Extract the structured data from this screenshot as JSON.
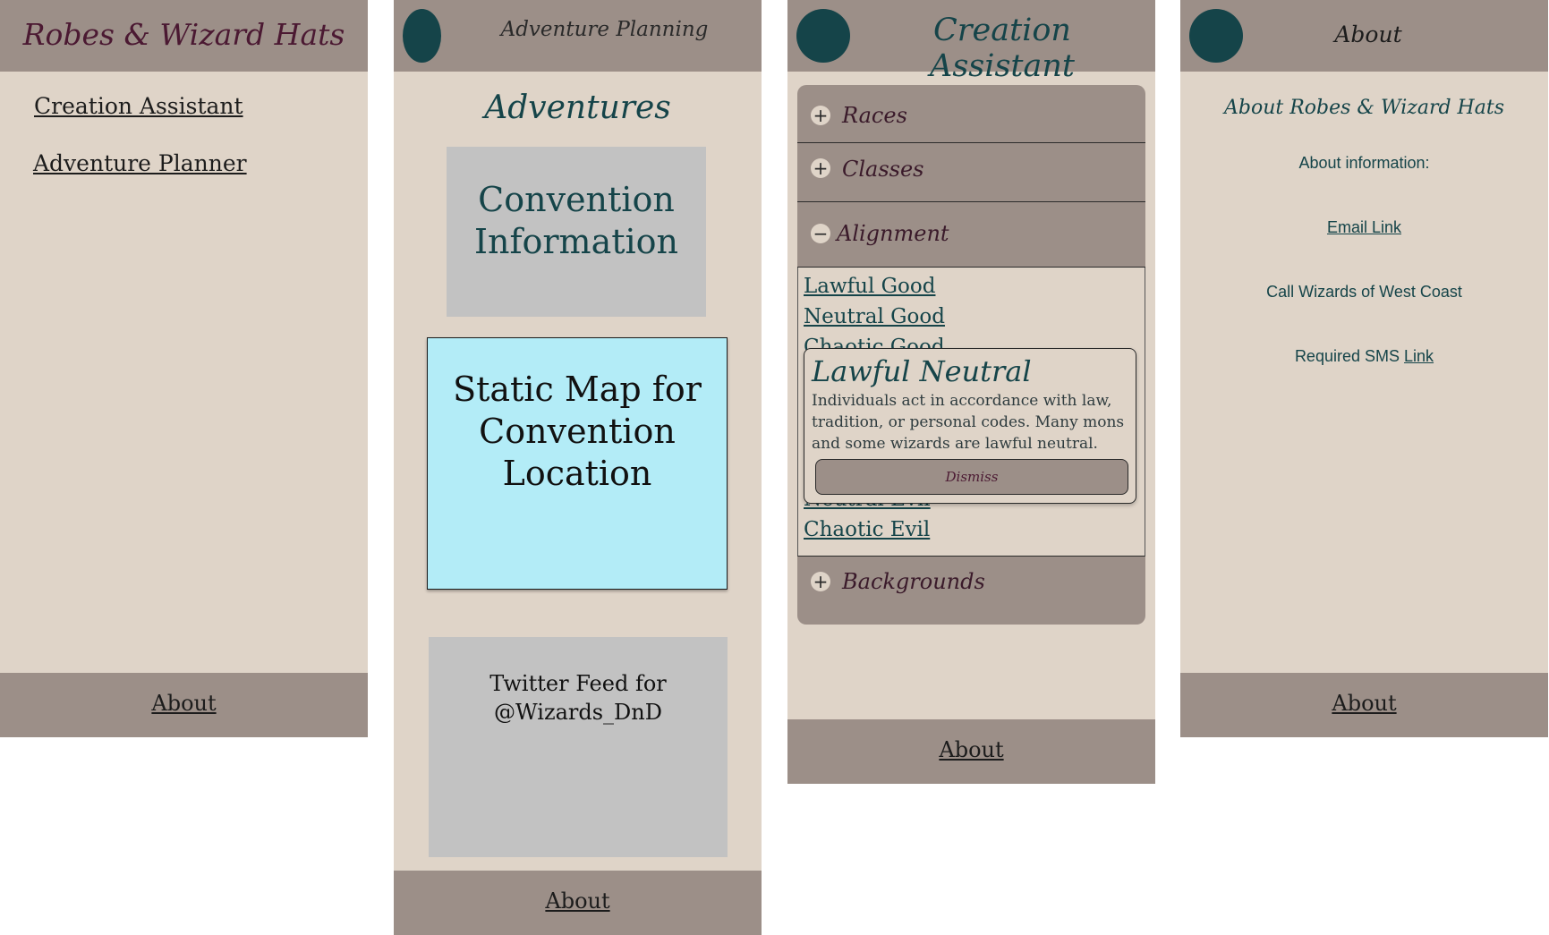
{
  "screen1": {
    "title": "Robes & Wizard Hats",
    "nav": [
      "Creation Assistant",
      "Adventure Planner"
    ],
    "footer_link": "About"
  },
  "screen2": {
    "header_title": "Adventure Planning",
    "heading": "Adventures",
    "convention_info": [
      "Convention",
      "Information"
    ],
    "static_map": [
      "Static Map for",
      "Convention",
      "Location"
    ],
    "twitter_feed": [
      "Twitter Feed for",
      "@Wizards_DnD"
    ],
    "footer_link": "About",
    "colors": {
      "map_box": "#b3ecf7",
      "placeholder_box": "#c2c2c2"
    }
  },
  "screen3": {
    "header_title": "Creation Assistant",
    "sections": [
      {
        "label": "Races",
        "icon": "plus-icon"
      },
      {
        "label": "Classes",
        "icon": "plus-icon"
      },
      {
        "label": "Alignment",
        "icon": "minus-icon"
      },
      {
        "label": "Backgrounds",
        "icon": "plus-icon"
      }
    ],
    "alignment_options": [
      "Lawful Good",
      "Neutral Good",
      "Chaotic Good",
      "Neutral Evil",
      "Chaotic Evil"
    ],
    "popup": {
      "title": "Lawful Neutral",
      "description": "Individuals act in accordance with law, tradition, or personal codes. Many mons and some wizards are lawful neutral.",
      "dismiss_label": "Dismiss"
    },
    "footer_link": "About"
  },
  "screen4": {
    "header_title": "About",
    "heading": "About Robes & Wizard Hats",
    "about_info": "About information:",
    "email_link": "Email Link",
    "call_text": "Call Wizards of West Coast",
    "sms_text": "Required SMS",
    "sms_link": "Link",
    "footer_link": "About"
  },
  "colors": {
    "header_bg": "#9c8f88",
    "body_bg": "#dfd4c8",
    "accent_teal": "#154449",
    "title_plum": "#4b1932"
  }
}
